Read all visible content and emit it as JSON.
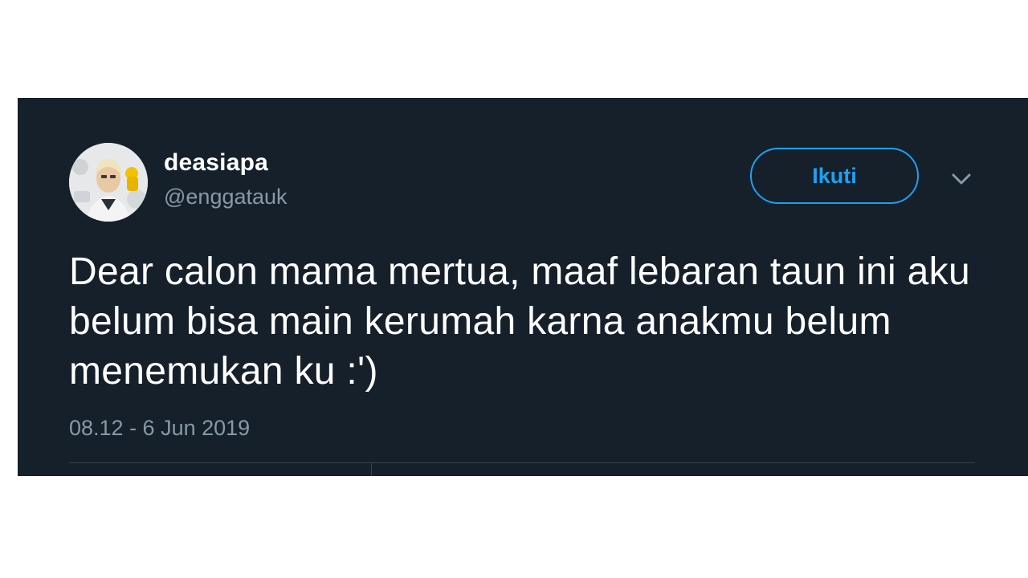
{
  "tweet": {
    "author": {
      "display_name": "deasiapa",
      "handle": "@enggatauk",
      "avatar_icon": "profile-photo"
    },
    "follow_button": {
      "label": "Ikuti"
    },
    "menu_icon": "chevron-down-icon",
    "text": "Dear calon mama mertua, maaf lebaran taun ini aku belum bisa main kerumah karna anakmu belum menemukan ku :')",
    "timestamp": "08.12 - 6 Jun 2019"
  },
  "colors": {
    "background": "#15202b",
    "text_primary": "#ffffff",
    "text_secondary": "#8899a6",
    "accent": "#1da1f2",
    "divider": "#38444d"
  }
}
